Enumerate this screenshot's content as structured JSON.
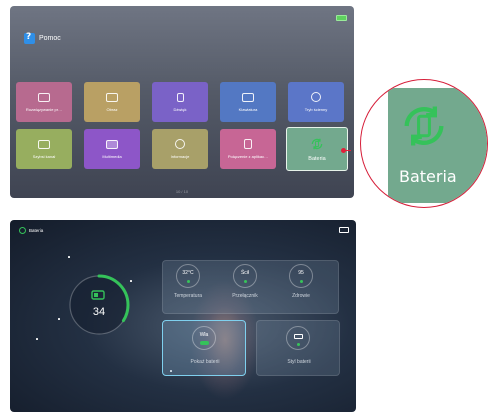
{
  "help_screen": {
    "title": "Pomoc",
    "tiles": [
      {
        "label": "Rozwiązywanie pr…",
        "color": "#b76a8f",
        "icon": "box-icon"
      },
      {
        "label": "Obraz",
        "color": "#b9a064",
        "icon": "image-icon"
      },
      {
        "label": "Dźwięk",
        "color": "#7a62c7",
        "icon": "speaker-icon"
      },
      {
        "label": "Klawiatura",
        "color": "#5378c3",
        "icon": "keyboard-icon"
      },
      {
        "label": "Tryb ścienny",
        "color": "#5b76c8",
        "icon": "wall-mode-icon"
      },
      {
        "label": "Szybsi kanał",
        "color": "#97ae5f",
        "icon": "tv-icon"
      },
      {
        "label": "Multimedia",
        "color": "#8d56c8",
        "icon": "media-icon"
      },
      {
        "label": "Informacje",
        "color": "#a8a069",
        "icon": "info-icon"
      },
      {
        "label": "Połączenie z aplikac…",
        "color": "#c76695",
        "icon": "phone-icon"
      },
      {
        "label": "Bateria",
        "color": "#73a98e",
        "icon": "battery-cycle-icon"
      }
    ],
    "pager": "10 / 10",
    "zoom_label": "Bateria",
    "accent": "#35c25a",
    "highlight": "#d61f3a"
  },
  "battery_screen": {
    "title": "Bateria",
    "level": "34",
    "level_fraction": 0.34,
    "stats": [
      {
        "value": "32°C",
        "label": "Temperatura"
      },
      {
        "value": "Ścił",
        "label": "Przełącznik"
      },
      {
        "value": "95",
        "label": "Zdrowie"
      }
    ],
    "cards": [
      {
        "value": "Wła",
        "label": "Pokaż baterii"
      },
      {
        "value": "",
        "label": "Styl baterii"
      }
    ]
  }
}
